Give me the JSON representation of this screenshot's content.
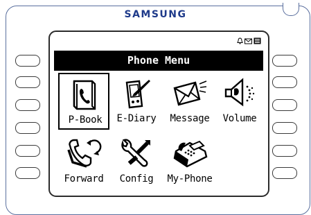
{
  "device": {
    "brand": "SAMSUNG"
  },
  "screen": {
    "status_icons": [
      "bell-icon",
      "envelope-icon",
      "phonebook-icon"
    ],
    "title": "Phone Menu",
    "selected_item": "P-Book",
    "menu_items": [
      {
        "label": "P-Book",
        "icon": "phonebook-icon"
      },
      {
        "label": "E-Diary",
        "icon": "pda-diary-icon"
      },
      {
        "label": "Message",
        "icon": "envelope-icon"
      },
      {
        "label": "Volume",
        "icon": "speaker-icon"
      },
      {
        "label": "Forward",
        "icon": "call-forward-icon"
      },
      {
        "label": "Config",
        "icon": "wrench-config-icon"
      },
      {
        "label": "My-Phone",
        "icon": "desk-phone-icon"
      }
    ]
  },
  "colors": {
    "brand": "#1e3a8a",
    "frame": "#5a6f9e",
    "title_bar": "#000000"
  }
}
